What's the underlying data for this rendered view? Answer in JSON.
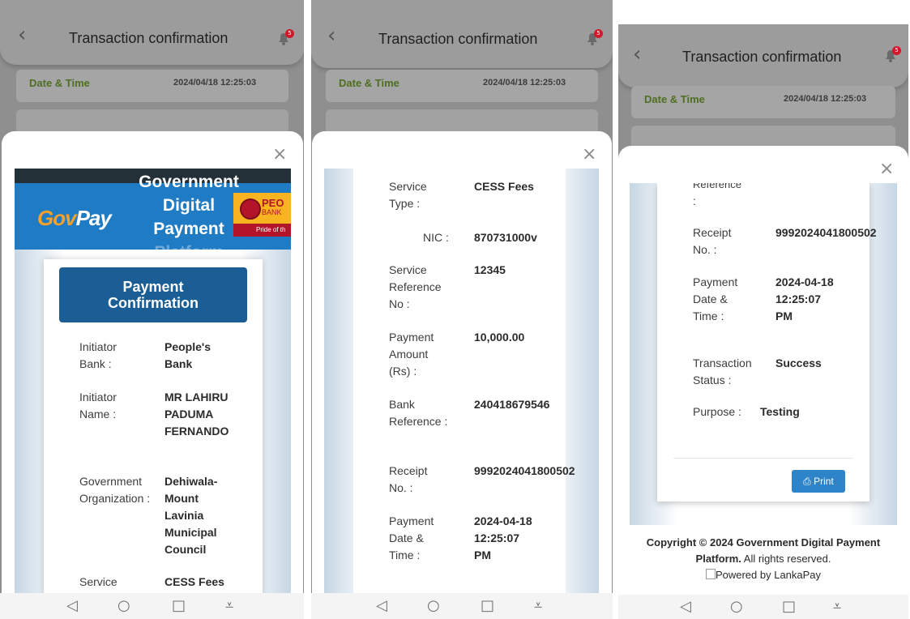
{
  "header": {
    "title": "Transaction confirmation",
    "notification_count": "5",
    "date_time_label": "Date & Time",
    "date_time_value": "2024/04/18 12:25:03"
  },
  "banner": {
    "brand": "GovPay",
    "line1": "Government",
    "line2": "Digital",
    "line3": "Payment",
    "line4": "Platform",
    "bank_logo_text": "PEO",
    "bank_logo_text2": "BANK",
    "bank_tagline": "Pride of th"
  },
  "receipt": {
    "heading_line1": "Payment",
    "heading_line2": "Confirmation",
    "initiator_bank_label": "Initiator Bank :",
    "initiator_bank_value": "People's Bank",
    "initiator_name_label": "Initiator Name :",
    "initiator_name_value": "MR LAHIRU PADUMA FERNANDO",
    "gov_org_label": "Government Organization :",
    "gov_org_value": "Dehiwala-Mount Lavinia Municipal Council",
    "service_label_partial": "Service",
    "service_type_label": "Service Type :",
    "service_type_value": "CESS Fees",
    "nic_label": "NIC :",
    "nic_value": "870731000v",
    "service_ref_label": "Service Reference No :",
    "service_ref_value": "12345",
    "amount_label": "Payment Amount (Rs) :",
    "amount_value": "10,000.00",
    "bank_ref_label": "Bank Reference :",
    "bank_ref_value": "240418679546",
    "receipt_no_label": "Receipt No. :",
    "receipt_no_value": "9992024041800502",
    "payment_dt_label": "Payment Date & Time :",
    "payment_dt_value": "2024-04-18 12:25:07 PM",
    "reference_partial": "Reference",
    "reference_colon": ":",
    "status_label": "Transaction Status :",
    "status_value": "Success",
    "purpose_label": "Purpose :",
    "purpose_value": "Testing",
    "print_label": "Print"
  },
  "footer": {
    "copyright": "Copyright © 2024 Government Digital Payment",
    "platform": "Platform.",
    "rights": "All rights reserved.",
    "powered": "Powered by LankaPay"
  },
  "colors": {
    "gov_blue": "#1f7bc3",
    "header_blue": "#1b5e95",
    "date_green": "#4f6e22",
    "badge_red": "#d0182b",
    "print_blue": "#2d84c9"
  },
  "icons": [
    "back-arrow-icon",
    "bell-icon",
    "close-icon",
    "printer-icon",
    "nav-back-icon",
    "nav-home-icon",
    "nav-recents-icon",
    "nav-menu-icon"
  ]
}
